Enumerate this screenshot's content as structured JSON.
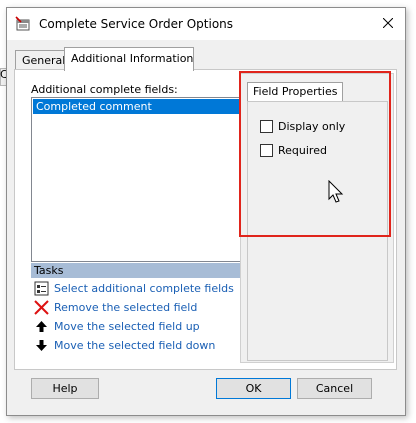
{
  "background": {
    "fragment_text": "Co"
  },
  "dialog": {
    "title": "Complete Service Order Options",
    "tabs": [
      {
        "label": "General",
        "active": false
      },
      {
        "label": "Additional Information",
        "active": true
      }
    ],
    "fields": {
      "label": "Additional complete fields:",
      "items": [
        "Completed comment"
      ]
    },
    "tasks": {
      "header": "Tasks",
      "items": [
        {
          "label": "Select additional complete fields",
          "icon": "select-fields-icon"
        },
        {
          "label": "Remove the selected field",
          "icon": "red-x-icon"
        },
        {
          "label": "Move the selected field up",
          "icon": "arrow-up-icon"
        },
        {
          "label": "Move the selected field down",
          "icon": "arrow-down-icon"
        }
      ]
    },
    "field_properties": {
      "tab_label": "Field Properties",
      "checkboxes": [
        {
          "label": "Display only",
          "checked": false
        },
        {
          "label": "Required",
          "checked": false
        }
      ]
    },
    "buttons": {
      "help": "Help",
      "ok": "OK",
      "cancel": "Cancel"
    }
  },
  "colors": {
    "selection": "#0078d7",
    "tasks_header": "#a7bcd6",
    "link": "#1a5fb4",
    "highlight": "#e0241b"
  }
}
